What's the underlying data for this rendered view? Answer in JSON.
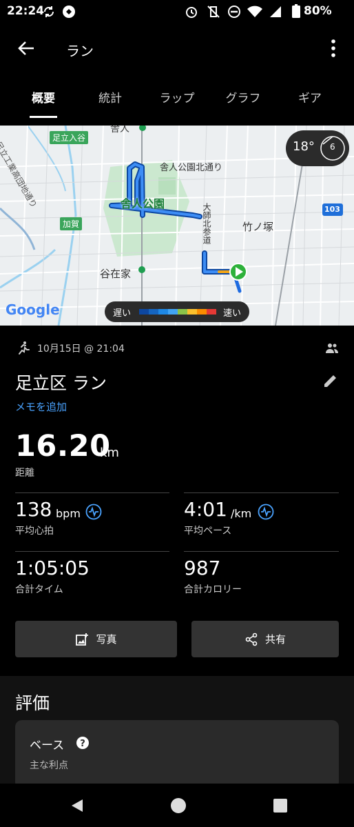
{
  "status_bar": {
    "time": "22:24",
    "battery": "80%"
  },
  "app_bar": {
    "title": "ラン"
  },
  "tabs": [
    {
      "label": "概要",
      "active": true
    },
    {
      "label": "統計",
      "active": false
    },
    {
      "label": "ラップ",
      "active": false
    },
    {
      "label": "グラフ",
      "active": false
    },
    {
      "label": "ギア",
      "active": false
    }
  ],
  "map": {
    "labels": {
      "park": "舎人公園",
      "street_north": "舎人公園北通り",
      "daishi": "大師北参道",
      "takenotsuka": "竹ノ塚",
      "yazaike": "谷在家",
      "toneri": "舎人",
      "adachi_iriya": "足立入谷",
      "kaga": "加賀",
      "route_103": "103",
      "high_school": "足立工業高団地通り",
      "google": "Google"
    },
    "legend": {
      "slow": "遅い",
      "fast": "速い"
    },
    "weather": {
      "temperature": "18°",
      "wind": "6"
    },
    "colors": {
      "route": "#1e6be0",
      "start": "#2db13a"
    }
  },
  "activity": {
    "date": "10月15日 @ 21:04",
    "title": "足立区 ラン",
    "add_memo": "メモを追加",
    "distance": {
      "value": "16.20",
      "unit": "km",
      "label": "距離"
    },
    "heart_rate": {
      "value": "138",
      "unit": "bpm",
      "label": "平均心拍"
    },
    "pace": {
      "value": "4:01",
      "unit": "/km",
      "label": "平均ペース"
    },
    "time": {
      "value": "1:05:05",
      "label": "合計タイム"
    },
    "calories": {
      "value": "987",
      "label": "合計カロリー"
    }
  },
  "buttons": {
    "photo": "写真",
    "share": "共有"
  },
  "rating": {
    "title": "評価",
    "card_title": "ベース",
    "card_subtitle": "主な利点"
  }
}
